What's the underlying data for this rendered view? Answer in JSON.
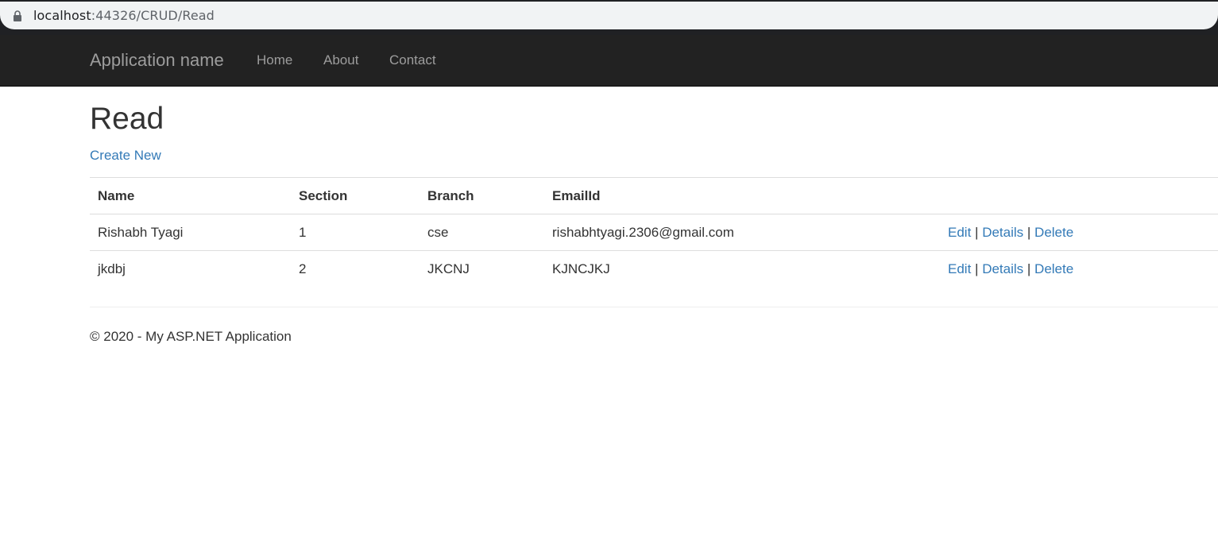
{
  "browser": {
    "url_host": "localhost",
    "url_path": ":44326/CRUD/Read"
  },
  "navbar": {
    "brand": "Application name",
    "links": [
      "Home",
      "About",
      "Contact"
    ]
  },
  "main": {
    "title": "Read",
    "create_link": "Create New",
    "table": {
      "headers": [
        "Name",
        "Section",
        "Branch",
        "EmailId"
      ],
      "rows": [
        {
          "name": "Rishabh Tyagi",
          "section": "1",
          "branch": "cse",
          "email": "rishabhtyagi.2306@gmail.com"
        },
        {
          "name": "jkdbj",
          "section": "2",
          "branch": "JKCNJ",
          "email": "KJNCJKJ"
        }
      ],
      "actions": {
        "edit": "Edit",
        "details": "Details",
        "delete": "Delete",
        "separator": "|"
      }
    }
  },
  "footer": {
    "text": "© 2020 - My ASP.NET Application"
  },
  "colors": {
    "navbar_bg": "#222222",
    "link": "#337ab7",
    "nav_text": "#9d9d9d"
  }
}
